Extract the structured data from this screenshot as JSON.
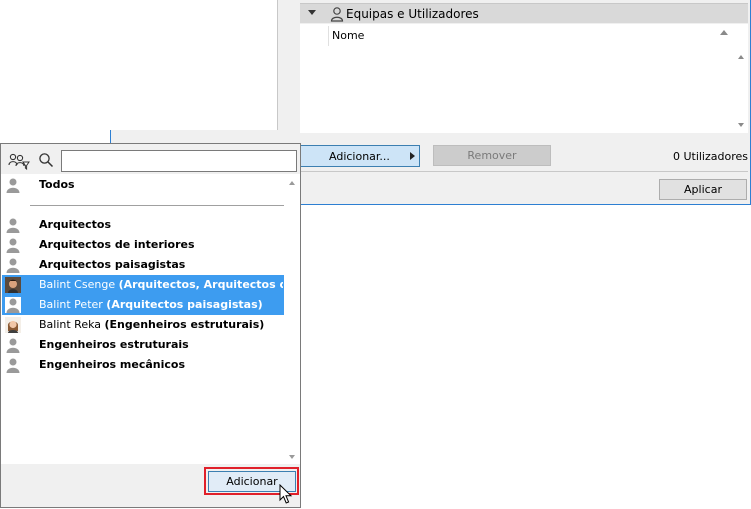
{
  "section": {
    "title": "Equipas e Utilizadores",
    "column_name": "Nome"
  },
  "toolbar": {
    "add_menu_label": "Adicionar...",
    "remove_label": "Remover",
    "count_label": "0 Utilizadores",
    "apply_label": "Aplicar"
  },
  "popup": {
    "search_value": "",
    "all_label": "Todos",
    "items": [
      {
        "type": "group",
        "name": "Arquitectos",
        "detail": "",
        "selected": false
      },
      {
        "type": "group",
        "name": "Arquitectos de interiores",
        "detail": "",
        "selected": false
      },
      {
        "type": "group",
        "name": "Arquitectos paisagistas",
        "detail": "",
        "selected": false
      },
      {
        "type": "user",
        "name": "Balint Csenge",
        "detail": "(Arquitectos, Arquitectos de in...",
        "selected": true
      },
      {
        "type": "user",
        "name": "Balint Peter",
        "detail": "(Arquitectos paisagistas)",
        "selected": true
      },
      {
        "type": "user",
        "name": "Balint Reka",
        "detail": "(Engenheiros estruturais)",
        "selected": false
      },
      {
        "type": "group",
        "name": "Engenheiros estruturais",
        "detail": "",
        "selected": false
      },
      {
        "type": "group",
        "name": "Engenheiros mecânicos",
        "detail": "",
        "selected": false
      }
    ],
    "add_label": "Adicionar"
  },
  "colors": {
    "selection": "#3d9cf0",
    "highlight": "#e0202a",
    "accent": "#2d7fd2"
  },
  "icons": [
    "filter-users-icon",
    "search-icon",
    "group-icon",
    "user-avatar-icon",
    "users-icon",
    "mouse-cursor-icon"
  ]
}
